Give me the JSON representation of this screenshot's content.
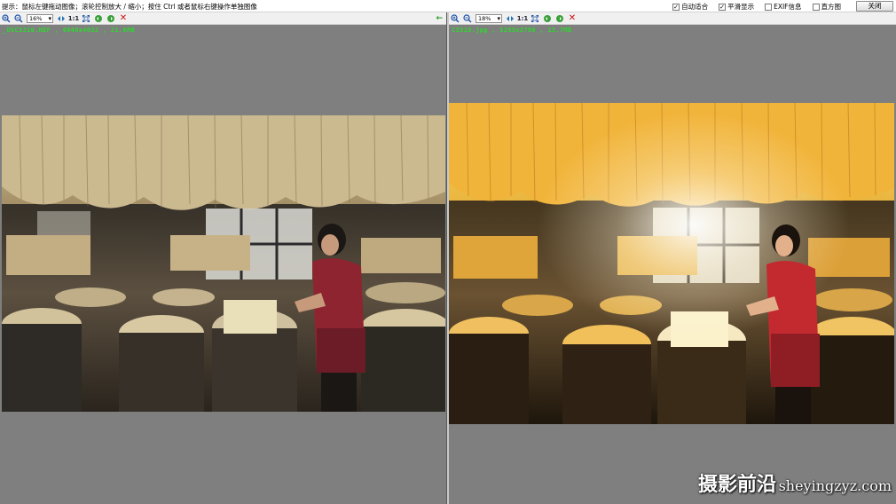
{
  "topbar": {
    "hint": "提示：鼠标左键拖动图像；滚轮控制放大 / 缩小；按住 Ctrl 或者鼠标右键操作单独图像",
    "options": [
      {
        "label": "自动适合",
        "checked": true
      },
      {
        "label": "平滑显示",
        "checked": true
      },
      {
        "label": "EXIF信息",
        "checked": false
      },
      {
        "label": "直方图",
        "checked": false
      }
    ],
    "close_label": "关闭"
  },
  "left_pane": {
    "zoom": "16%",
    "one_to_one": "1:1",
    "file_info": "_DSC3310.NEF , 6048x4032 , 21.6MB"
  },
  "right_pane": {
    "zoom": "18%",
    "one_to_one": "1:1",
    "file_info": "C3310.jpg , 5285x3790 , 15.7MB"
  },
  "watermark": {
    "cn": "摄影前沿",
    "en": "sheyingzyz.com"
  },
  "icons": {
    "zoom_in": "zoom-in-icon",
    "zoom_out": "zoom-out-icon",
    "fit": "fit-icon",
    "fullscreen": "fullscreen-icon",
    "rotate_left": "rotate-left-icon",
    "rotate_right": "rotate-right-icon",
    "close": "close-icon",
    "sync": "sync-arrow-icon"
  }
}
